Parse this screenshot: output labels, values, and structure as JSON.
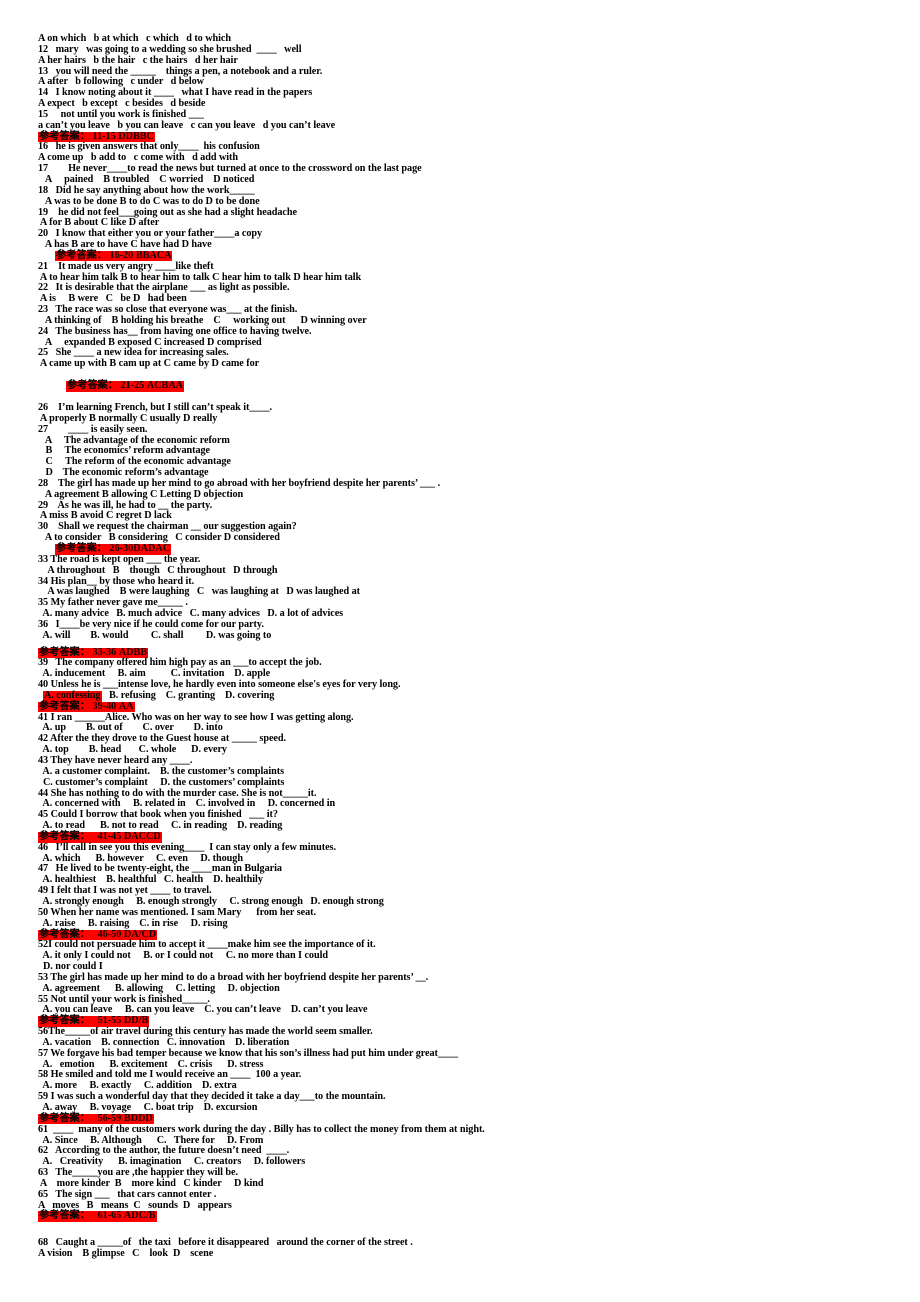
{
  "document": {
    "type": "english-multiple-choice-exam",
    "answer_key_label": "参考答案：",
    "highlight_color": "#FF0000",
    "page_background": "#FFFFFF",
    "text_color": "#000000"
  },
  "lines": [
    {
      "id": "l1",
      "indent": 0,
      "text": "A on which   b at which   c which   d to which"
    },
    {
      "id": "l2",
      "indent": 0,
      "text": "12   mary   was going to a wedding so she brushed  ____   well"
    },
    {
      "id": "l3",
      "indent": 0,
      "text": "A her hairs   b the hair   c the hairs   d her hair"
    },
    {
      "id": "l4",
      "indent": 0,
      "text": "13   you will need the _____    things a pen, a notebook and a ruler."
    },
    {
      "id": "l5",
      "indent": 0,
      "text": "A after   b following   c under   d below"
    },
    {
      "id": "l6",
      "indent": 0,
      "text": "14   I know noting about it ____   what I have read in the papers"
    },
    {
      "id": "l7",
      "indent": 0,
      "text": "A expect   b except   c besides   d beside"
    },
    {
      "id": "l8",
      "indent": 0,
      "text": "15     not until you work is finished ___"
    },
    {
      "id": "l9",
      "indent": 0,
      "text": "a can’t you leave   b you can leave   c can you leave   d you can’t leave"
    }
  ],
  "answer_keys": {
    "k11_15": {
      "label": "参考答案：",
      "range": "11-15",
      "answers": "DDBBC",
      "indent": 0
    },
    "k16_20": {
      "label": "参考答案：",
      "range": "16-20",
      "answers": "BBACA",
      "indent": 17
    },
    "k21_25": {
      "label": "参考答案：",
      "range": "21-25",
      "answers": "ACBAA",
      "indent": 28
    },
    "k26_30": {
      "label": "参考答案：",
      "range": "26-30",
      "answers": "DADAC",
      "indent": 17
    },
    "k33_36": {
      "label": "参考答案：",
      "range": "33-36",
      "answers": "ADBB",
      "indent": 0
    },
    "k39_40": {
      "label": "参考答案：",
      "range": "39-40",
      "answers": "AA",
      "indent": 0
    },
    "k41_45": {
      "label": "参考答案：",
      "range": "41-45",
      "answers": "DACCD",
      "indent": 0
    },
    "k46_50": {
      "label": "参考答案：",
      "range": "46-50",
      "answers": "DA/CD",
      "indent": 0
    },
    "k51_55": {
      "label": "参考答案：",
      "range": "51-55",
      "answers": "DD/B",
      "indent": 0
    },
    "k56_59": {
      "label": "参考答案：",
      "range": "56-59",
      "answers": "BDDD",
      "indent": 0
    },
    "k61_65": {
      "label": "参考答案：",
      "range": "61-65",
      "answers": "ADC/B",
      "indent": 0
    }
  },
  "block2": [
    {
      "id": "b2l1",
      "indent": 0,
      "text": "16   he is given answers that only____  his confusion"
    },
    {
      "id": "b2l2",
      "indent": 0,
      "text": "A come up   b add to   c come with   d add with"
    },
    {
      "id": "b2l3",
      "indent": 0,
      "text": "17        He never____to read the news but turned at once to the crossword on the last page"
    },
    {
      "id": "b2l4",
      "indent": 0,
      "text": "   A     pained    B troubled    C worried    D noticed"
    },
    {
      "id": "b2l5",
      "indent": 0,
      "text": "18   Did he say anything about how the work_____"
    },
    {
      "id": "b2l6",
      "indent": 0,
      "text": "   A was to be done B to do C was to do D to be done"
    },
    {
      "id": "b2l7",
      "indent": 0,
      "text": "19    he did not feel___going out as she had a slight headache"
    },
    {
      "id": "b2l8",
      "indent": 0,
      "text": " A for B about C like D after"
    },
    {
      "id": "b2l9",
      "indent": 0,
      "text": "20   I know that either you or your father____a copy"
    },
    {
      "id": "b2l10",
      "indent": 0,
      "text": "   A has B are to have C have had D have"
    }
  ],
  "block3": [
    {
      "id": "b3l1",
      "indent": 0,
      "text": "21    It made us very angry ____like theft"
    },
    {
      "id": "b3l2",
      "indent": 0,
      "text": " A to hear him talk B to hear him to talk C hear him to talk D hear him talk"
    },
    {
      "id": "b3l3",
      "indent": 0,
      "text": "22   It is desirable that the airplane ___ as light as possible."
    },
    {
      "id": "b3l4",
      "indent": 0,
      "text": " A is     B were   C   be D   had been"
    },
    {
      "id": "b3l5",
      "indent": 0,
      "text": "23   The race was so close that everyone was___ at the finish."
    },
    {
      "id": "b3l6",
      "indent": 0,
      "text": "   A thinking of    B holding his breathe    C     working out      D winning over"
    },
    {
      "id": "b3l7",
      "indent": 0,
      "text": "24   The business has__ from having one office to having twelve."
    },
    {
      "id": "b3l8",
      "indent": 0,
      "text": "   A     expanded B exposed C increased D comprised"
    },
    {
      "id": "b3l9",
      "indent": 0,
      "text": "25   She ____ a new idea for increasing sales."
    },
    {
      "id": "b3l10",
      "indent": 0,
      "text": " A came up with B cam up at C came by D came for"
    }
  ],
  "block4": [
    {
      "id": "b4l1",
      "indent": 0,
      "text": "26    I’m learning French, but I still can’t speak it____."
    },
    {
      "id": "b4l2",
      "indent": 0,
      "text": " A properly B normally C usually D really"
    },
    {
      "id": "b4l3",
      "indent": 0,
      "text": "27        ____ is easily seen."
    },
    {
      "id": "b4l4",
      "indent": 0,
      "text": "   A     The advantage of the economic reform"
    },
    {
      "id": "b4l5",
      "indent": 0,
      "text": "   B     The economics’ reform advantage"
    },
    {
      "id": "b4l6",
      "indent": 0,
      "text": "   C     The reform of the economic advantage"
    },
    {
      "id": "b4l7",
      "indent": 0,
      "text": "   D    The economic reform’s advantage"
    },
    {
      "id": "b4l8",
      "indent": 0,
      "text": "28    The girl has made up her mind to go abroad with her boyfriend despite her parents’ ___ ."
    },
    {
      "id": "b4l9",
      "indent": 0,
      "text": "   A agreement B allowing C Letting D objection"
    },
    {
      "id": "b4l10",
      "indent": 0,
      "text": "29    As he was ill, he had to __ the party."
    },
    {
      "id": "b4l11",
      "indent": 0,
      "text": " A miss B avoid C regret D lack"
    },
    {
      "id": "b4l12",
      "indent": 0,
      "text": "30    Shall we request the chairman __ our suggestion again?"
    },
    {
      "id": "b4l13",
      "indent": 0,
      "text": "   A to consider   B considering   C consider D considered"
    }
  ],
  "block5": [
    {
      "id": "b5l1",
      "indent": 0,
      "text": "33 The road is kept open ___ the year."
    },
    {
      "id": "b5l2",
      "indent": 0,
      "text": "    A throughout   B    though   C throughout   D through"
    },
    {
      "id": "b5l3",
      "indent": 0,
      "text": "34 His plan__ by those who heard it."
    },
    {
      "id": "b5l4",
      "indent": 0,
      "text": "    A was laughed    B were laughing   C   was laughing at   D was laughed at"
    },
    {
      "id": "b5l5",
      "indent": 0,
      "text": "35 My father never gave me_____ ."
    },
    {
      "id": "b5l6",
      "indent": 0,
      "text": "  A. many advice   B. much advice   C. many advices   D. a lot of advices"
    },
    {
      "id": "b5l7",
      "indent": 0,
      "text": "36   I____be very nice if he could come for our party."
    },
    {
      "id": "b5l8",
      "indent": 0,
      "text": "  A. will        B. would         C. shall         D. was going to"
    }
  ],
  "block6": [
    {
      "id": "b6l1",
      "indent": 0,
      "text": "39   The company offered him high pay as an ___to accept the job."
    },
    {
      "id": "b6l2",
      "indent": 0,
      "text": "  A. inducement     B. aim          C. invitation    D. apple"
    },
    {
      "id": "b6l3",
      "indent": 0,
      "text": "40 Unless he is ___intense love, he hardly even into someone else's eyes for very long."
    },
    {
      "id": "b6l4_pre",
      "indent": 0,
      "text": "  "
    },
    {
      "id": "b6l4_hl",
      "indent": 0,
      "text": "A. confessing"
    },
    {
      "id": "b6l4_post",
      "indent": 0,
      "text": "   B. refusing    C. granting    D. covering"
    }
  ],
  "block7": [
    {
      "id": "b7l1",
      "indent": 0,
      "text": "41 I ran ______Alice. Who was on her way to see how I was getting along."
    },
    {
      "id": "b7l2",
      "indent": 0,
      "text": "  A. up        B. out of        C. over        D. into"
    },
    {
      "id": "b7l3",
      "indent": 0,
      "text": "42 After the they drove to the Guest house at _____ speed."
    },
    {
      "id": "b7l4",
      "indent": 0,
      "text": "  A. top        B. head       C. whole      D. every"
    },
    {
      "id": "b7l5",
      "indent": 0,
      "text": "43 They have never heard any ____."
    },
    {
      "id": "b7l6",
      "indent": 0,
      "text": "  A. a customer complaint.    B. the customer’s complaints"
    },
    {
      "id": "b7l7",
      "indent": 0,
      "text": "  C. customer’s complaint     D. the customers’ complaints"
    },
    {
      "id": "b7l8",
      "indent": 0,
      "text": "44 She has nothing to do with the murder case. She is not_____it."
    },
    {
      "id": "b7l9",
      "indent": 0,
      "text": "  A. concerned with     B. related in    C. involved in     D. concerned in"
    },
    {
      "id": "b7l10",
      "indent": 0,
      "text": "45 Could I borrow that book when you finished   ___ it?"
    },
    {
      "id": "b7l11",
      "indent": 0,
      "text": "  A. to read      B. not to read     C. in reading    D. reading"
    }
  ],
  "block8": [
    {
      "id": "b8l1",
      "indent": 0,
      "text": "46   I’ll call in see you this evening____  I can stay only a few minutes."
    },
    {
      "id": "b8l2",
      "indent": 0,
      "text": "  A. which      B. however     C. even     D. though"
    },
    {
      "id": "b8l3",
      "indent": 0,
      "text": "47   He lived to be twenty-eight, the ____man in Bulgaria"
    },
    {
      "id": "b8l4",
      "indent": 0,
      "text": "  A. healthiest    B. healthful   C. health    D. healthily"
    },
    {
      "id": "b8l5",
      "indent": 0,
      "text": "49 I felt that I was not yet ____ to travel."
    },
    {
      "id": "b8l6",
      "indent": 0,
      "text": "  A. strongly enough     B. enough strongly     C. strong enough   D. enough strong"
    },
    {
      "id": "b8l7",
      "indent": 0,
      "text": "50 When her name was mentioned. I sam Mary      from her seat."
    },
    {
      "id": "b8l8",
      "indent": 0,
      "text": "  A. raise     B. raising    C. in rise     D. rising"
    }
  ],
  "block9": [
    {
      "id": "b9l1",
      "indent": 0,
      "text": "52I could not persuade him to accept it ____make him see the importance of it."
    },
    {
      "id": "b9l2",
      "indent": 0,
      "text": "  A. it only I could not     B. or I could not     C. no more than I could"
    },
    {
      "id": "b9l3",
      "indent": 0,
      "text": "  D. nor could I"
    },
    {
      "id": "b9l4",
      "indent": 0,
      "text": "53 The girl has made up her mind to do a broad with her boyfriend despite her parents’ __."
    },
    {
      "id": "b9l5",
      "indent": 0,
      "text": "  A. agreement      B. allowing     C. letting     D. objection"
    },
    {
      "id": "b9l6",
      "indent": 0,
      "text": "55 Not until your work is finished_____."
    },
    {
      "id": "b9l7",
      "indent": 0,
      "text": "  A. you can leave     B. can you leave    C. you can’t leave    D. can’t you leave"
    }
  ],
  "block10": [
    {
      "id": "b10l1",
      "indent": 0,
      "text": "56The_____of air travel during this century has made the world seem smaller."
    },
    {
      "id": "b10l2",
      "indent": 0,
      "text": "  A. vacation    B. connection   C. innovation    D. liberation"
    },
    {
      "id": "b10l3",
      "indent": 0,
      "text": "57 We forgave his bad temper because we know that his son’s illness had put him under great____"
    },
    {
      "id": "b10l4",
      "indent": 0,
      "text": "  A.   emotion      B. excitement    C. crisis      D. stress"
    },
    {
      "id": "b10l5",
      "indent": 0,
      "text": "58 He smiled and told me I would receive an ____  100 a year."
    },
    {
      "id": "b10l6",
      "indent": 0,
      "text": "  A. more     B. exactly     C. addition    D. extra"
    },
    {
      "id": "b10l7",
      "indent": 0,
      "text": "59 I was such a wonderful day that they decided it take a day___to the mountain."
    },
    {
      "id": "b10l8",
      "indent": 0,
      "text": "  A. away     B. voyage     C. boat trip    D. excursion"
    }
  ],
  "block11": [
    {
      "id": "b11l1",
      "indent": 0,
      "text": "61  ____  many of the customers work during the day . Billy has to collect the money from them at night."
    },
    {
      "id": "b11l2",
      "indent": 0,
      "text": "  A. Since     B. Although      C.   There for     D. From"
    },
    {
      "id": "b11l3",
      "indent": 0,
      "text": "62   According to the author, the future doesn’t need  ____."
    },
    {
      "id": "b11l4",
      "indent": 0,
      "text": "  A.   Creativity      B. imagination     C. creators     D. followers"
    },
    {
      "id": "b11l5",
      "indent": 0,
      "text": "63   The_____you are ,the happier they will be."
    },
    {
      "id": "b11l6",
      "indent": 0,
      "text": " A    more kinder  B    more kind   C kinder     D kind"
    },
    {
      "id": "b11l7",
      "indent": 0,
      "text": "65   The sign ___   that cars cannot enter ."
    },
    {
      "id": "b11l8",
      "indent": 0,
      "text": "A   moves   B   means  C   sounds  D   appears"
    }
  ],
  "block12": [
    {
      "id": "b12l1",
      "indent": 0,
      "text": "68   Caught a _____of   the taxi   before it disappeared   around the corner of the street ."
    },
    {
      "id": "b12l2",
      "indent": 0,
      "text": "A vision    B glimpse   C    look  D    scene"
    }
  ]
}
